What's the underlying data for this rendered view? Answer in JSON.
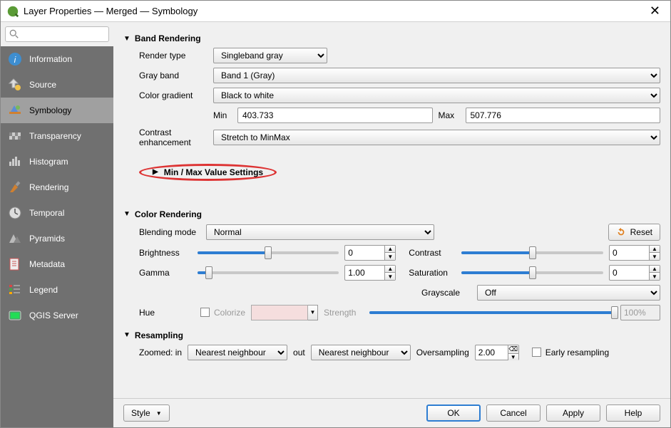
{
  "window": {
    "title": "Layer Properties — Merged — Symbology"
  },
  "sidebar": {
    "items": [
      {
        "label": "Information"
      },
      {
        "label": "Source"
      },
      {
        "label": "Symbology"
      },
      {
        "label": "Transparency"
      },
      {
        "label": "Histogram"
      },
      {
        "label": "Rendering"
      },
      {
        "label": "Temporal"
      },
      {
        "label": "Pyramids"
      },
      {
        "label": "Metadata"
      },
      {
        "label": "Legend"
      },
      {
        "label": "QGIS Server"
      }
    ]
  },
  "band_rendering": {
    "header": "Band Rendering",
    "render_type_label": "Render type",
    "render_type_value": "Singleband gray",
    "gray_band_label": "Gray band",
    "gray_band_value": "Band 1 (Gray)",
    "color_gradient_label": "Color gradient",
    "color_gradient_value": "Black to white",
    "min_label": "Min",
    "min_value": "403.733",
    "max_label": "Max",
    "max_value": "507.776",
    "contrast_label": "Contrast enhancement",
    "contrast_value": "Stretch to MinMax",
    "minmax_settings_header": "Min / Max Value Settings"
  },
  "color_rendering": {
    "header": "Color Rendering",
    "blending_label": "Blending mode",
    "blending_value": "Normal",
    "reset_label": "Reset",
    "brightness_label": "Brightness",
    "brightness_value": "0",
    "contrast_label": "Contrast",
    "contrast_value": "0",
    "gamma_label": "Gamma",
    "gamma_value": "1.00",
    "saturation_label": "Saturation",
    "saturation_value": "0",
    "grayscale_label": "Grayscale",
    "grayscale_value": "Off",
    "hue_label": "Hue",
    "colorize_label": "Colorize",
    "strength_label": "Strength",
    "strength_pct": "100%"
  },
  "resampling": {
    "header": "Resampling",
    "zoomed_in_label": "Zoomed: in",
    "zoomed_in_value": "Nearest neighbour",
    "out_label": "out",
    "out_value": "Nearest neighbour",
    "oversampling_label": "Oversampling",
    "oversampling_value": "2.00",
    "early_label": "Early resampling"
  },
  "footer": {
    "style_label": "Style",
    "ok": "OK",
    "cancel": "Cancel",
    "apply": "Apply",
    "help": "Help"
  }
}
